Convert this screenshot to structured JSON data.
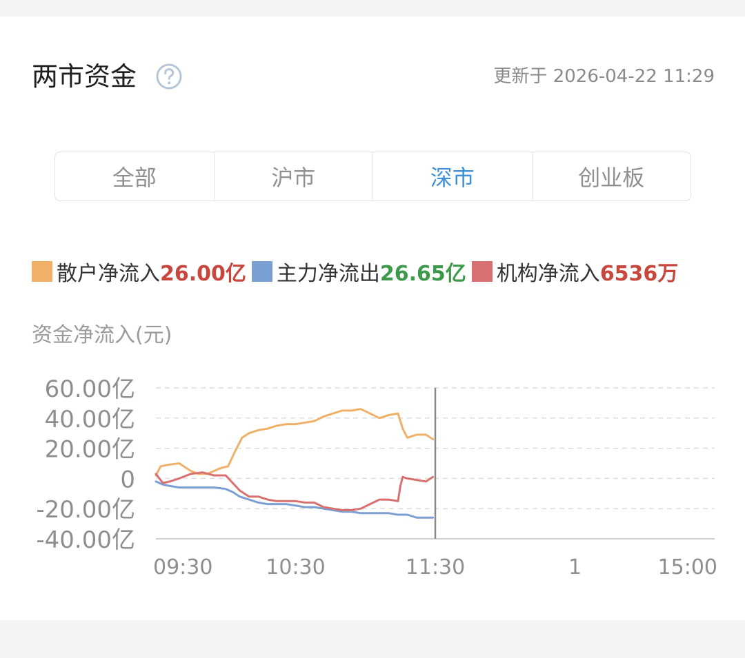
{
  "header": {
    "title": "两市资金",
    "updated": "更新于 2026-04-22 11:29"
  },
  "tabs": [
    {
      "label": "全部",
      "active": false
    },
    {
      "label": "沪市",
      "active": false
    },
    {
      "label": "深市",
      "active": true
    },
    {
      "label": "创业板",
      "active": false
    }
  ],
  "legend": [
    {
      "name": "散户净流入",
      "value": "26.00亿",
      "swatch": "#f0b068",
      "value_color": "#c9463d"
    },
    {
      "name": "主力净流出",
      "value": "26.65亿",
      "swatch": "#7a9fd2",
      "value_color": "#3e9a4b"
    },
    {
      "name": "机构净流入",
      "value": "6536万",
      "swatch": "#d97070",
      "value_color": "#c9463d"
    }
  ],
  "chart_data": {
    "type": "line",
    "ylabel": "资金净流入(元)",
    "ylim": [
      -40,
      60
    ],
    "yticks": [
      {
        "value": 60,
        "label": "60.00亿"
      },
      {
        "value": 40,
        "label": "40.00亿"
      },
      {
        "value": 20,
        "label": "20.00亿"
      },
      {
        "value": 0,
        "label": "0"
      },
      {
        "value": -20,
        "label": "-20.00亿"
      },
      {
        "value": -40,
        "label": "-40.00亿"
      }
    ],
    "xlim": [
      0,
      240
    ],
    "xticks": [
      {
        "value": 0,
        "label": "09:30"
      },
      {
        "value": 60,
        "label": "10:30"
      },
      {
        "value": 120,
        "label": "11:30"
      },
      {
        "value": 180,
        "label": "1"
      },
      {
        "value": 240,
        "label": "15:00"
      }
    ],
    "divider_x": 120,
    "grid": true,
    "series": [
      {
        "name": "散户净流入",
        "color": "#f0b068",
        "x": [
          0,
          2,
          5,
          10,
          15,
          18,
          22,
          25,
          28,
          31,
          34,
          37,
          40,
          44,
          48,
          52,
          56,
          60,
          64,
          68,
          72,
          76,
          80,
          84,
          88,
          92,
          96,
          100,
          104,
          106,
          108,
          112,
          116,
          119
        ],
        "y": [
          2,
          8,
          9,
          10,
          5,
          3,
          3,
          5,
          7,
          8,
          18,
          27,
          30,
          32,
          33,
          35,
          36,
          36,
          37,
          38,
          41,
          43,
          45,
          45,
          46,
          43,
          40,
          42,
          43,
          33,
          27,
          29,
          29,
          26
        ]
      },
      {
        "name": "主力净流出",
        "color": "#7a9fd2",
        "x": [
          0,
          3,
          6,
          10,
          15,
          20,
          25,
          30,
          33,
          36,
          40,
          44,
          48,
          52,
          56,
          60,
          64,
          68,
          72,
          76,
          80,
          84,
          88,
          92,
          96,
          100,
          104,
          108,
          112,
          116,
          119
        ],
        "y": [
          -2,
          -4,
          -5,
          -6,
          -6,
          -6,
          -6,
          -7,
          -9,
          -12,
          -14,
          -16,
          -17,
          -17,
          -17,
          -18,
          -19,
          -19,
          -20,
          -21,
          -22,
          -22,
          -23,
          -23,
          -23,
          -23,
          -24,
          -24,
          -26,
          -26,
          -26
        ]
      },
      {
        "name": "机构净流入",
        "color": "#d97070",
        "x": [
          0,
          3,
          6,
          10,
          15,
          20,
          25,
          30,
          33,
          36,
          40,
          44,
          48,
          52,
          56,
          60,
          64,
          68,
          72,
          76,
          80,
          84,
          88,
          92,
          96,
          100,
          104,
          105,
          106,
          108,
          112,
          116,
          119
        ],
        "y": [
          3,
          -3,
          -2,
          0,
          3,
          4,
          2,
          2,
          -3,
          -8,
          -12,
          -12,
          -14,
          -15,
          -15,
          -15,
          -16,
          -16,
          -19,
          -20,
          -21,
          -21,
          -20,
          -17,
          -14,
          -14,
          -15,
          -5,
          1,
          0,
          -1,
          -2,
          1
        ]
      }
    ]
  }
}
